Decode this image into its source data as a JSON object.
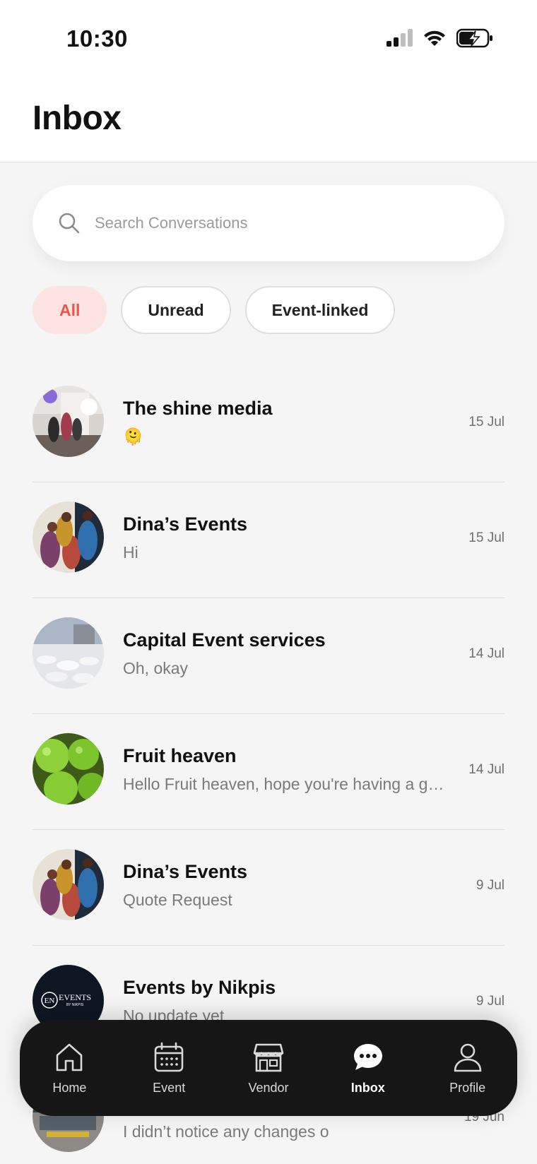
{
  "status_bar": {
    "time": "10:30"
  },
  "header": {
    "title": "Inbox"
  },
  "search": {
    "placeholder": "Search Conversations"
  },
  "filters": [
    {
      "label": "All",
      "active": true
    },
    {
      "label": "Unread",
      "active": false
    },
    {
      "label": "Event-linked",
      "active": false
    }
  ],
  "conversations": [
    {
      "name": "The shine media",
      "preview": "🫠",
      "date": "15 Jul"
    },
    {
      "name": "Dina’s Events",
      "preview": "Hi",
      "date": "15 Jul"
    },
    {
      "name": "Capital Event services",
      "preview": "Oh, okay",
      "date": "14 Jul"
    },
    {
      "name": "Fruit heaven",
      "preview": "Hello Fruit heaven, hope you're having a go...",
      "date": "14 Jul"
    },
    {
      "name": "Dina’s Events",
      "preview": "Quote Request",
      "date": "9 Jul"
    },
    {
      "name": "Events by Nikpis",
      "preview": "No update yet",
      "date": "9 Jul",
      "logo_text": "EVENTS",
      "logo_sub": "BY NIKPIS",
      "logo_mono": "EN"
    },
    {
      "name": "",
      "preview": "I didn’t notice any changes o",
      "date": "19 Jun"
    }
  ],
  "nav": {
    "items": [
      {
        "label": "Home",
        "icon": "home-icon"
      },
      {
        "label": "Event",
        "icon": "calendar-icon"
      },
      {
        "label": "Vendor",
        "icon": "store-icon"
      },
      {
        "label": "Inbox",
        "icon": "chat-bubble-icon",
        "active": true
      },
      {
        "label": "Profile",
        "icon": "person-icon"
      }
    ]
  },
  "colors": {
    "accent": "#e8574b",
    "accent_bg": "#fde4e2",
    "nav_bg": "#161616"
  }
}
